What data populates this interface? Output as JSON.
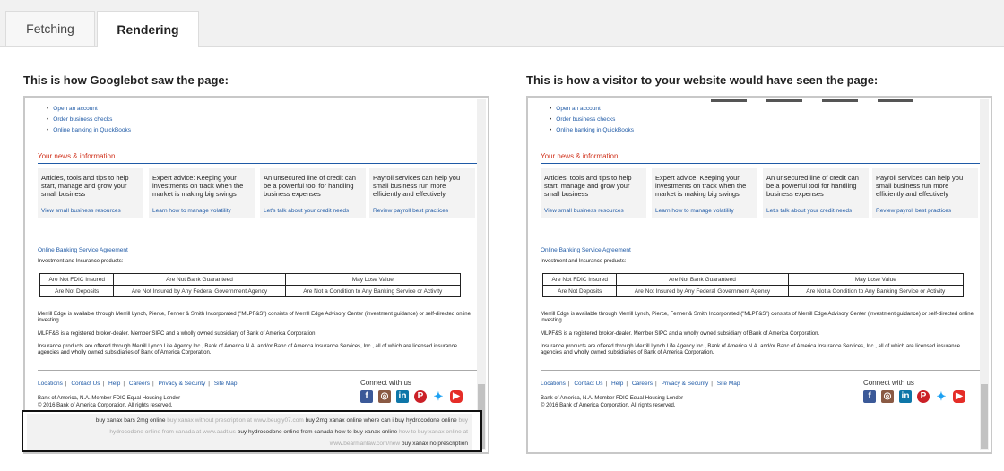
{
  "tabs": {
    "fetching": "Fetching",
    "rendering": "Rendering"
  },
  "left_heading": "This is how Googlebot saw the page:",
  "right_heading": "This is how a visitor to your website would have seen the page:",
  "page": {
    "bullets": [
      "Open an account",
      "Order business checks",
      "Online banking in QuickBooks"
    ],
    "news_heading": "Your news & information",
    "cards": [
      {
        "text": "Articles, tools and tips to help start, manage and grow your small business",
        "link": "View small business resources"
      },
      {
        "text": "Expert advice: Keeping your investments on track when the market is making big swings",
        "link": "Learn how to manage volatility"
      },
      {
        "text": "An unsecured line of credit can be a powerful tool for handling business expenses",
        "link": "Let's talk about your credit needs"
      },
      {
        "text": "Payroll services can help you small business run more efficiently and effectively",
        "link": "Review payroll best practices"
      }
    ],
    "service_agreement": "Online Banking Service Agreement",
    "investment_label": "Investment and Insurance products:",
    "disclosure": {
      "row1": [
        "Are Not FDIC Insured",
        "Are Not Bank Guaranteed",
        "May Lose Value"
      ],
      "row2": [
        "Are Not Deposits",
        "Are Not Insured by Any Federal Government Agency",
        "Are Not a Condition to Any Banking Service or Activity"
      ]
    },
    "para1": "Merrill Edge is available through Merrill Lynch, Pierce, Fenner & Smith Incorporated (\"MLPF&S\") consists of Merrill Edge Advisory Center (investment guidance) or self-directed online investing.",
    "para2": "MLPF&S is a registered broker-dealer. Member SIPC and a wholly owned subsidiary of Bank of America Corporation.",
    "para3": "Insurance products are offered through Merrill Lynch Life Agency Inc., Bank of America N.A. and/or Banc of America Insurance Services, Inc., all of which are licensed insurance agencies and wholly owned subsidiaries of Bank of America Corporation.",
    "footer_links": [
      "Locations",
      "Contact Us",
      "Help",
      "Careers",
      "Privacy & Security",
      "Site Map"
    ],
    "connect": "Connect with us",
    "legal1": "Bank of America, N.A. Member FDIC Equal Housing Lender",
    "legal2": "© 2016 Bank of America Corporation. All rights reserved."
  },
  "spam": {
    "line1_dark": "buy xanax bars 2mg online",
    "line1_gray": " buy xanax without prescription at www.beugly07.com ",
    "line1_dark2": "buy 2mg xanax online where can i buy hydrocodone online",
    "line1_gray2": " buy",
    "line2_gray": "hydrocodone online from canada at www.aadt.us ",
    "line2_dark": "buy hydrocodone online from canada how to buy xanax online",
    "line2_gray2": " how to buy xanax online at",
    "line3_gray": "www.bearmanlaw.com/new ",
    "line3_dark": "buy xanax no prescription"
  }
}
